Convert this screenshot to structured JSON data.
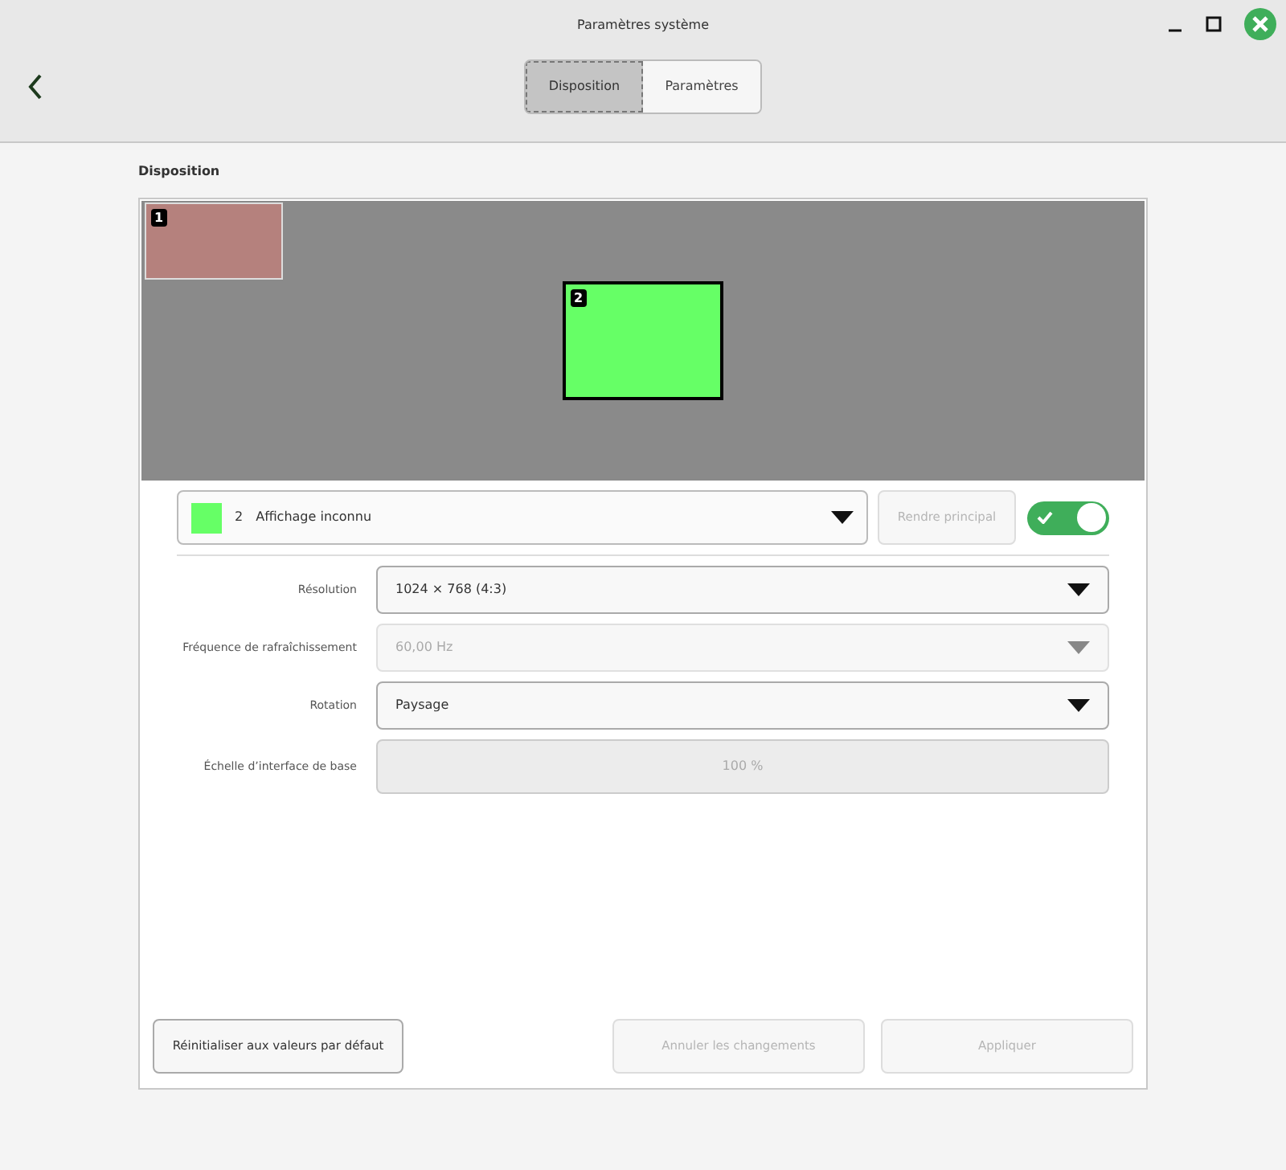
{
  "window": {
    "title": "Paramètres système"
  },
  "tabs": [
    {
      "label": "Disposition",
      "selected": true
    },
    {
      "label": "Paramètres",
      "selected": false
    }
  ],
  "section_title": "Disposition",
  "monitors": [
    {
      "number": "1",
      "color": "#b5817d",
      "selected": false
    },
    {
      "number": "2",
      "color": "#66ff66",
      "selected": true
    }
  ],
  "display_select": {
    "number": "2",
    "name": "Affichage inconnu",
    "color": "#66ff66"
  },
  "make_primary": {
    "label": "Rendre principal",
    "disabled": true
  },
  "display_enabled": {
    "on": true
  },
  "settings": [
    {
      "label": "Résolution",
      "value": "1024 × 768 (4:3)",
      "kind": "dropdown",
      "disabled": false
    },
    {
      "label": "Fréquence de rafraîchissement",
      "value": "60,00 Hz",
      "kind": "dropdown",
      "disabled": true
    },
    {
      "label": "Rotation",
      "value": "Paysage",
      "kind": "dropdown",
      "disabled": false
    },
    {
      "label": "Échelle d’interface de base",
      "value": "100 %",
      "kind": "scale",
      "disabled": true
    }
  ],
  "buttons": [
    {
      "label": "Réinitialiser aux valeurs par défaut",
      "disabled": false
    },
    {
      "label": "Annuler les changements",
      "disabled": true
    },
    {
      "label": "Appliquer",
      "disabled": true
    }
  ]
}
